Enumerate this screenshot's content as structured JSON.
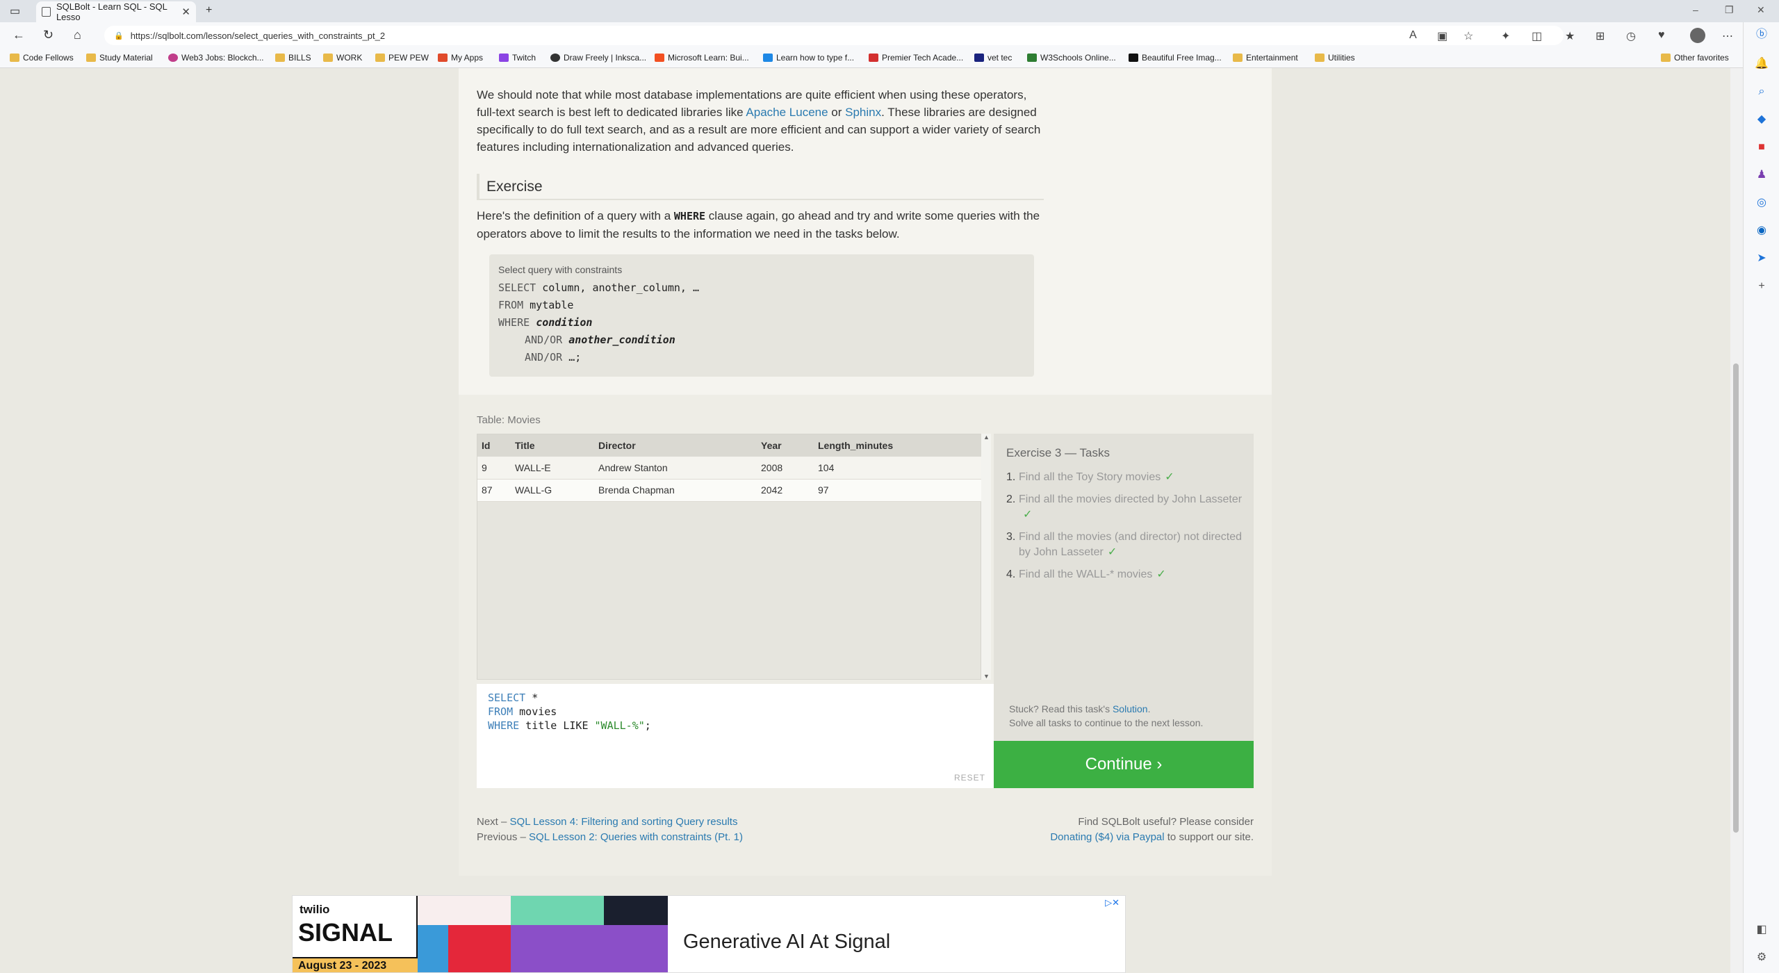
{
  "browser": {
    "tab_title": "SQLBolt - Learn SQL - SQL Lesso",
    "url": "https://sqlbolt.com/lesson/select_queries_with_constraints_pt_2",
    "bookmarks": [
      "Code Fellows",
      "Study Material",
      "Web3 Jobs: Blockch...",
      "BILLS",
      "WORK",
      "PEW PEW",
      "My Apps",
      "Twitch",
      "Draw Freely | Inksca...",
      "Microsoft Learn: Bui...",
      "Learn how to type f...",
      "Premier Tech Acade...",
      "vet tec",
      "W3Schools Online...",
      "Beautiful Free Imag...",
      "Entertainment",
      "Utilities"
    ],
    "other_favorites": "Other favorites"
  },
  "article": {
    "p1_a": "We should note that while most database implementations are quite efficient when using these operators, full-text search is best left to dedicated libraries like ",
    "link_lucene": "Apache Lucene",
    "p1_or": " or ",
    "link_sphinx": "Sphinx",
    "p1_b": ". These libraries are designed specifically to do full text search, and as a result are more efficient and can support a wider variety of search features including internationalization and advanced queries.",
    "exercise_heading": "Exercise",
    "p2_a": "Here's the definition of a query with a ",
    "p2_kw": "WHERE",
    "p2_b": " clause again, go ahead and try and write some queries with the operators above to limit the results to the information we need in the tasks below.",
    "code_caption": "Select query with constraints",
    "code": {
      "l1_kw": "SELECT",
      "l1": " column, another_column, …",
      "l2_kw": "FROM",
      "l2": " mytable",
      "l3_kw": "WHERE",
      "l3": "condition",
      "l4_kw": "AND/OR",
      "l4": "another_condition",
      "l5_kw": "AND/OR",
      "l5": " …;"
    }
  },
  "exercise": {
    "table_label": "Table: Movies",
    "columns": [
      "Id",
      "Title",
      "Director",
      "Year",
      "Length_minutes"
    ],
    "rows": [
      [
        "9",
        "WALL-E",
        "Andrew Stanton",
        "2008",
        "104"
      ],
      [
        "87",
        "WALL-G",
        "Brenda Chapman",
        "2042",
        "97"
      ]
    ],
    "query": {
      "kw1": "SELECT",
      "v1": " *",
      "kw2": "FROM",
      "v2": " movies",
      "kw3": "WHERE",
      "v3": " title LIKE ",
      "str": "\"WALL-%\"",
      "end": ";"
    },
    "reset": "RESET",
    "tasks_title": "Exercise 3 — Tasks",
    "tasks": [
      {
        "num": "1.",
        "text": "Find all the Toy Story movies"
      },
      {
        "num": "2.",
        "text": "Find all the movies directed by John Lasseter"
      },
      {
        "num": "3.",
        "text": "Find all the movies (and director) not directed by John Lasseter"
      },
      {
        "num": "4.",
        "text": "Find all the WALL-* movies"
      }
    ],
    "check": "✓",
    "stuck_a": "Stuck? Read this task's ",
    "stuck_link": "Solution",
    "stuck_b": ".",
    "stuck_line2": "Solve all tasks to continue to the next lesson.",
    "continue": "Continue ›",
    "next_prefix": "Next – ",
    "next_link": "SQL Lesson 4: Filtering and sorting Query results",
    "prev_prefix": "Previous – ",
    "prev_link": "SQL Lesson 2: Queries with constraints (Pt. 1)",
    "donate_line1": "Find SQLBolt useful? Please consider",
    "donate_link": "Donating ($4) via Paypal",
    "donate_suffix": " to support our site."
  },
  "ad": {
    "brand": "twilio",
    "event": "SIGNAL",
    "date": "August 23 - 2023",
    "headline": "Generative AI At Signal"
  }
}
